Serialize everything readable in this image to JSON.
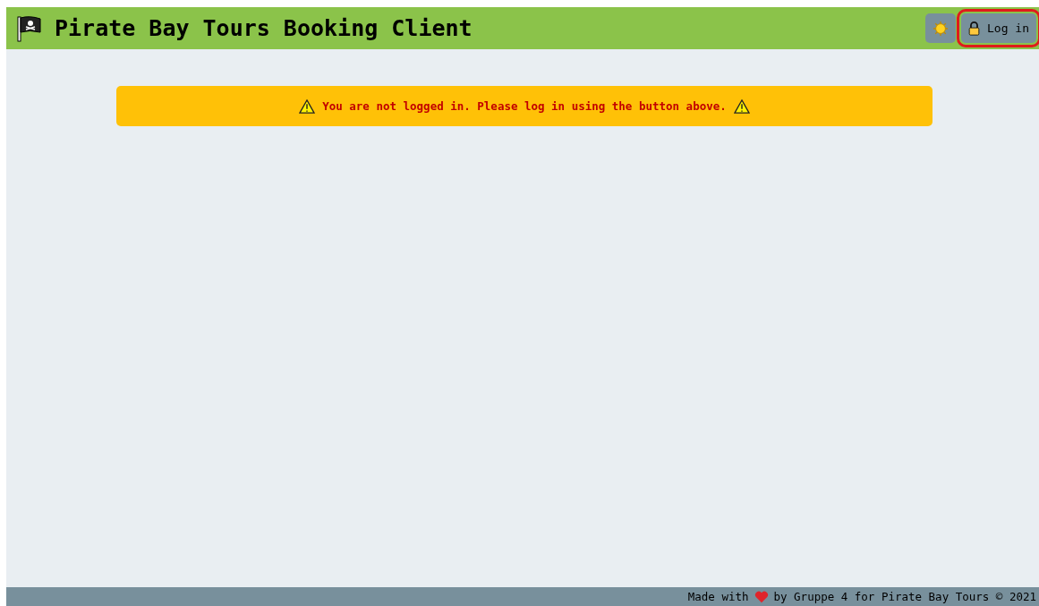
{
  "header": {
    "title": "Pirate Bay Tours Booking Client",
    "login_button": {
      "label": "Log in",
      "focused": true
    }
  },
  "alert": {
    "message": "You are not logged in. Please log in using the button above."
  },
  "footer": {
    "before": "Made with",
    "after": "by Gruppe 4 for Pirate Bay Tours © 2021"
  }
}
